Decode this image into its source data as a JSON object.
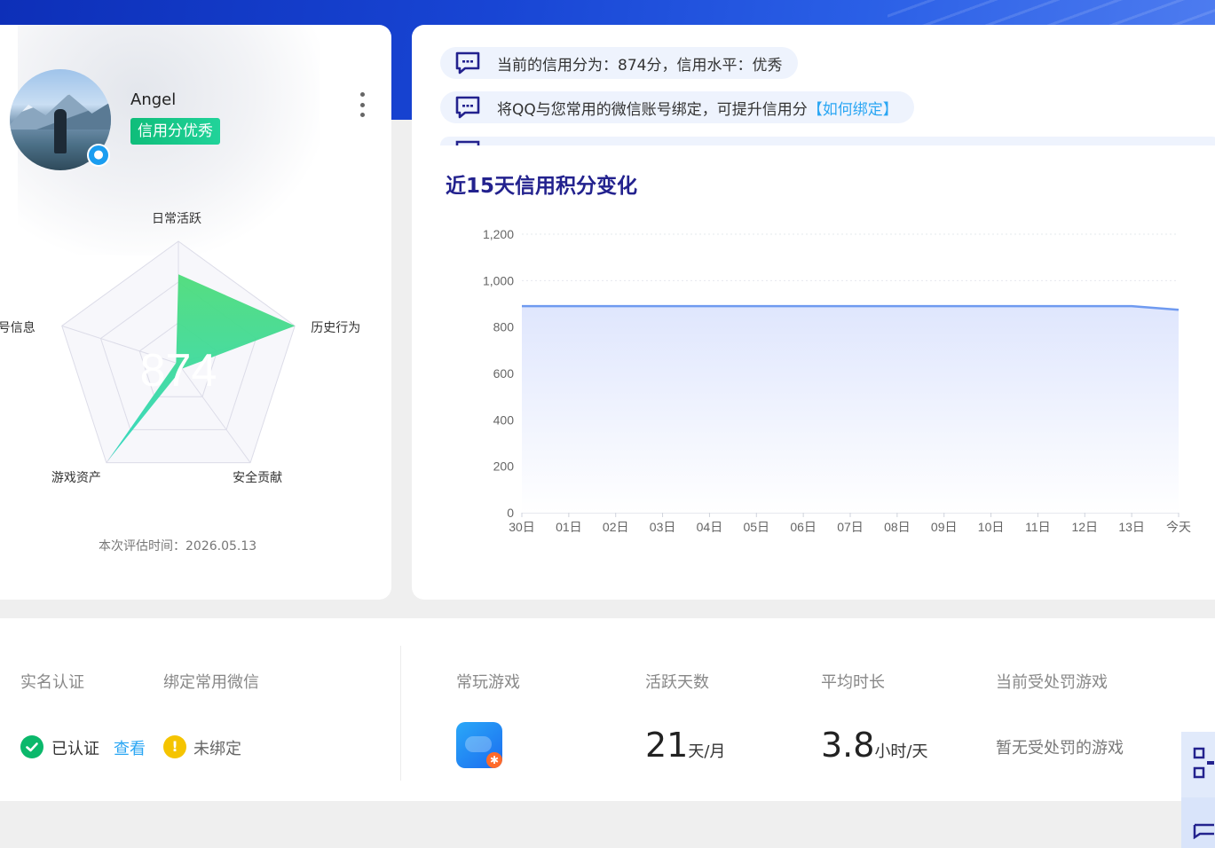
{
  "profile": {
    "username": "Angel",
    "credit_tag": "信用分优秀",
    "score": "874",
    "eval_time": "本次评估时间：2026.05.13"
  },
  "radar": {
    "axes": [
      "日常活跃",
      "历史行为",
      "安全贡献",
      "游戏资产",
      "账号信息"
    ],
    "values": [
      0.73,
      1.0,
      0.05,
      0.98,
      0.02
    ],
    "fill_start": "#4ddc7a",
    "fill_end": "#2fd8c0"
  },
  "tips": {
    "t1": "当前的信用分为：874分，信用水平：优秀",
    "t2": "将QQ与您常用的微信账号绑定，可提升信用分",
    "t2_link": "【如何绑定】"
  },
  "chart_data": {
    "type": "area",
    "title": "近15天信用积分变化",
    "categories": [
      "30日",
      "01日",
      "02日",
      "03日",
      "04日",
      "05日",
      "06日",
      "07日",
      "08日",
      "09日",
      "10日",
      "11日",
      "12日",
      "13日",
      "今天"
    ],
    "values": [
      890,
      890,
      890,
      890,
      890,
      890,
      890,
      890,
      890,
      890,
      890,
      890,
      890,
      890,
      874
    ],
    "yticks": [
      "0",
      "200",
      "400",
      "600",
      "800",
      "1,000",
      "1,200"
    ],
    "ylim": [
      0,
      1200
    ],
    "line_color": "#6f9af0",
    "grid": true
  },
  "bottom": {
    "realname_label": "实名认证",
    "realname_status": "已认证",
    "view_link": "查看",
    "wechat_label": "绑定常用微信",
    "wechat_status": "未绑定",
    "games_label": "常玩游戏",
    "active_label": "活跃天数",
    "active_value": "21",
    "active_unit": "天/月",
    "avg_label": "平均时长",
    "avg_value": "3.8",
    "avg_unit": "小时/天",
    "punish_label": "当前受处罚游戏",
    "punish_value": "暂无受处罚的游戏"
  }
}
